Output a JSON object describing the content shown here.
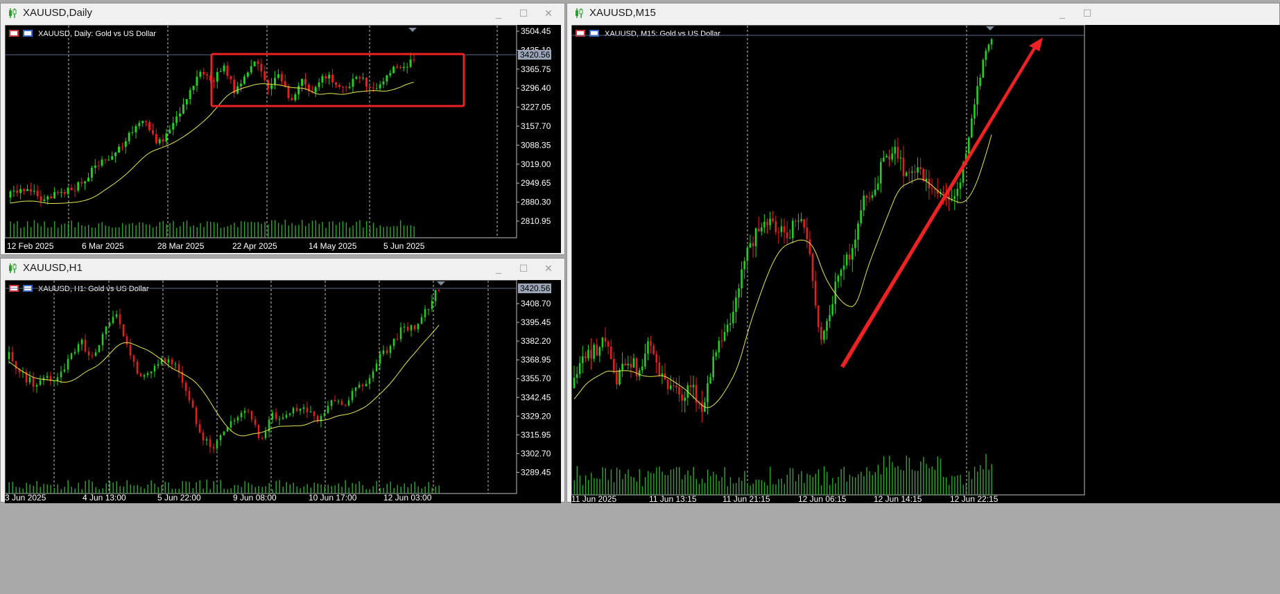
{
  "windows": {
    "daily": {
      "title": "XAUUSD,Daily",
      "header": "XAUUSD, Daily:  Gold vs US Dollar",
      "current_price": "3420.56",
      "price_labels": [
        "3504.45",
        "3435.10",
        "3365.75",
        "3296.40",
        "3227.05",
        "3157.70",
        "3088.35",
        "3019.00",
        "2949.65",
        "2880.30",
        "2810.95"
      ],
      "date_labels": [
        "12 Feb 2025",
        "6 Mar 2025",
        "28 Mar 2025",
        "22 Apr 2025",
        "14 May 2025",
        "5 Jun 2025"
      ]
    },
    "h1": {
      "title": "XAUUSD,H1",
      "header": "XAUUSD, H1:  Gold vs US Dollar",
      "current_price": "3420.56",
      "price_labels": [
        "3408.70",
        "3395.45",
        "3382.20",
        "3368.95",
        "3355.70",
        "3342.45",
        "3329.20",
        "3315.95",
        "3302.70",
        "3289.45"
      ],
      "date_labels": [
        "3 Jun 2025",
        "4 Jun 13:00",
        "5 Jun 22:00",
        "9 Jun 08:00",
        "10 Jun 17:00",
        "12 Jun 03:00"
      ]
    },
    "m15": {
      "title": "XAUUSD,M15",
      "header": "XAUUSD, M15:  Gold vs US Dollar",
      "date_labels": [
        "11 Jun 2025",
        "11 Jun 13:15",
        "11 Jun 21:15",
        "12 Jun 06:15",
        "12 Jun 14:15",
        "12 Jun 22:15"
      ]
    }
  },
  "colors": {
    "bull": "#22d022",
    "bear": "#e81e1e",
    "ma": "#e8e84a",
    "annotation": "#ee2222",
    "volume": "#2ea82e",
    "grid": "#c0c0c0"
  },
  "icons": {
    "window_icon": "candlestick-chart-icon",
    "minimize": "minimize-icon",
    "maximize": "maximize-icon",
    "close": "close-icon"
  },
  "controls": {
    "minimize": "_",
    "maximize": "☐",
    "close": "✕"
  }
}
